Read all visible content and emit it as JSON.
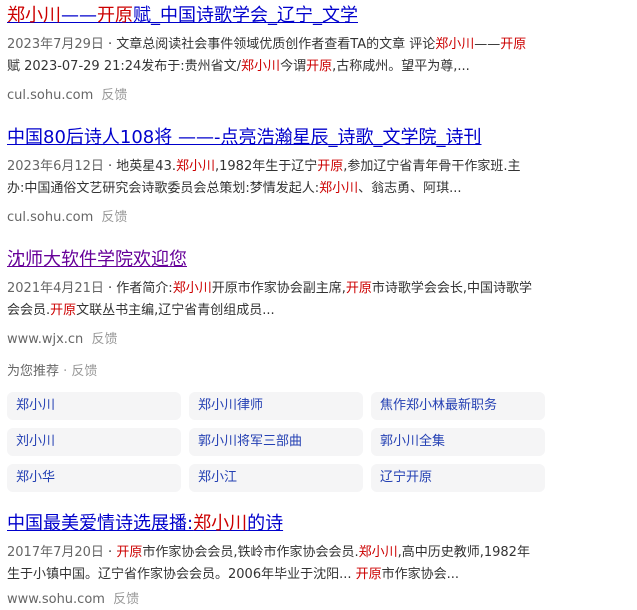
{
  "results": [
    {
      "title_parts": [
        {
          "t": "郑小川",
          "hl": true
        },
        {
          "t": "——",
          "hl": false
        },
        {
          "t": "开原",
          "hl": true
        },
        {
          "t": "赋_中国诗歌学会_辽宁_文学",
          "hl": false
        }
      ],
      "abstract_parts": [
        {
          "t": "2023年7月29日",
          "date": true
        },
        {
          "t": " · 文章总阅读社会事件领域优质创作者查看TA的文章 评论",
          "hl": false
        },
        {
          "t": "郑小川",
          "hl": true
        },
        {
          "t": "——",
          "hl": false
        },
        {
          "t": "开原",
          "hl": true
        },
        {
          "t": "赋 2023-07-29 21:24发布于:贵州省文/",
          "hl": false
        },
        {
          "t": "郑小川",
          "hl": true
        },
        {
          "t": "今谓",
          "hl": false
        },
        {
          "t": "开原",
          "hl": true
        },
        {
          "t": ",古称咸州。望平为尊,...",
          "hl": false
        }
      ],
      "source": "cul.sohu.com",
      "feedback": "反馈"
    },
    {
      "title_parts": [
        {
          "t": "中国80后诗人108将 ——-点亮浩瀚星辰_诗歌_文学院_诗刊",
          "hl": false
        }
      ],
      "abstract_parts": [
        {
          "t": "2023年6月12日",
          "date": true
        },
        {
          "t": " · 地英星43.",
          "hl": false
        },
        {
          "t": "郑小川",
          "hl": true
        },
        {
          "t": ",1982年生于辽宁",
          "hl": false
        },
        {
          "t": "开原",
          "hl": true
        },
        {
          "t": ",参加辽宁省青年骨干作家班.主 办:中国通俗文艺研究会诗歌委员会总策划:梦情发起人:",
          "hl": false
        },
        {
          "t": "郑小川",
          "hl": true
        },
        {
          "t": "、翁志勇、阿琪...",
          "hl": false
        }
      ],
      "source": "cul.sohu.com",
      "feedback": "反馈"
    },
    {
      "visited": true,
      "title_parts": [
        {
          "t": "沈师大软件学院欢迎您",
          "hl": false
        }
      ],
      "abstract_parts": [
        {
          "t": "2021年4月21日",
          "date": true
        },
        {
          "t": " · 作者简介:",
          "hl": false
        },
        {
          "t": "郑小川",
          "hl": true
        },
        {
          "t": "开原市作家协会副主席,",
          "hl": false
        },
        {
          "t": "开原",
          "hl": true
        },
        {
          "t": "市诗歌学会会长,中国诗歌学会会员.",
          "hl": false
        },
        {
          "t": "开原",
          "hl": true
        },
        {
          "t": "文联丛书主编,辽宁省青创组成员...",
          "hl": false
        }
      ],
      "source": "www.wjx.cn",
      "feedback": "反馈"
    }
  ],
  "recommend": {
    "label": "为您推荐",
    "feedback": "反馈",
    "items": [
      "郑小川",
      "郑小川律师",
      "焦作郑小林最新职务",
      "刘小川",
      "郭小川将军三部曲",
      "郭小川全集",
      "郑小华",
      "郑小江",
      "辽宁开原"
    ]
  },
  "last_result": {
    "title_parts": [
      {
        "t": "中国最美爱情诗选展播:",
        "hl": false
      },
      {
        "t": "郑小川",
        "hl": true
      },
      {
        "t": "的诗",
        "hl": false
      }
    ],
    "abstract_parts": [
      {
        "t": "2017年7月20日",
        "date": true
      },
      {
        "t": " · ",
        "hl": false
      },
      {
        "t": "开原",
        "hl": true
      },
      {
        "t": "市作家协会会员,铁岭市作家协会会员.",
        "hl": false
      },
      {
        "t": "郑小川",
        "hl": true
      },
      {
        "t": ",高中历史教师,1982年生于小镇中国。辽宁省作家协会会员。2006年毕业于沈阳... ",
        "hl": false
      },
      {
        "t": "开原",
        "hl": true
      },
      {
        "t": "市作家协会...",
        "hl": false
      }
    ],
    "source": "www.sohu.com",
    "feedback": "反馈"
  }
}
